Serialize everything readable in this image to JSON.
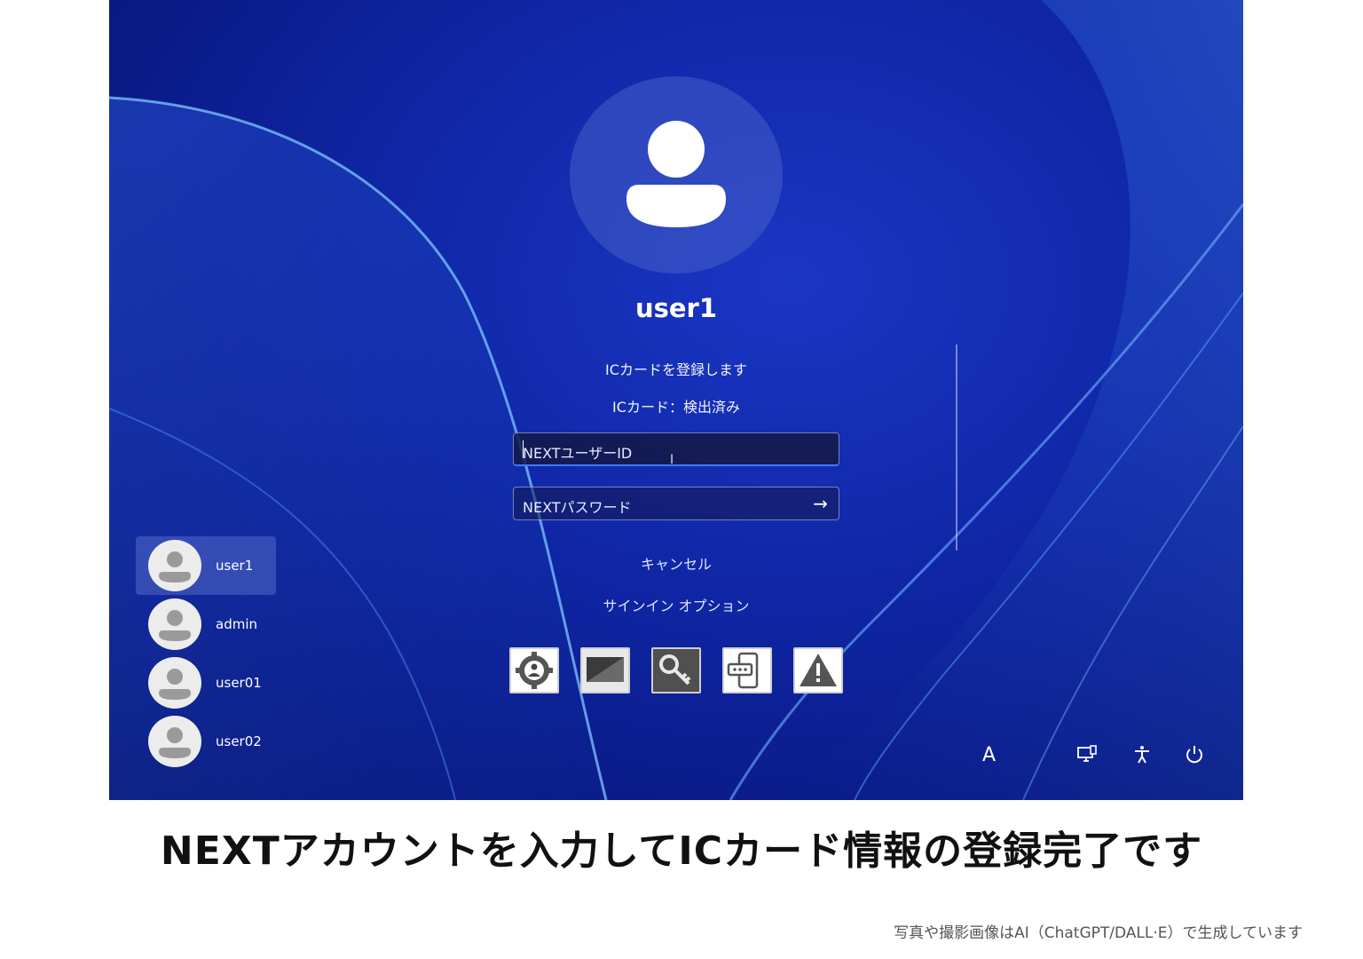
{
  "login": {
    "username": "user1",
    "message1": "ICカードを登録します",
    "message2": "ICカード：検出済み",
    "userid_placeholder": "NEXTユーザーID",
    "password_placeholder": "NEXTパスワード",
    "cancel_label": "キャンセル",
    "signin_options_label": "サインイン オプション"
  },
  "user_list": [
    {
      "name": "user1",
      "selected": true
    },
    {
      "name": "admin",
      "selected": false
    },
    {
      "name": "user01",
      "selected": false
    },
    {
      "name": "user02",
      "selected": false
    }
  ],
  "signin_options": [
    {
      "icon": "settings-user-icon"
    },
    {
      "icon": "smartcard-icon"
    },
    {
      "icon": "key-icon"
    },
    {
      "icon": "phone-code-icon"
    },
    {
      "icon": "warning-icon"
    }
  ],
  "tray": {
    "input_indicator": "A",
    "icons": [
      "network-icon",
      "accessibility-icon",
      "power-icon"
    ]
  },
  "caption": "NEXTアカウントを入力してICカード情報の登録完了です",
  "note": "写真や撮影画像はAI（ChatGPT/DALL·E）で生成しています",
  "colors": {
    "accent": "#3c7bff",
    "background": "#1027a8"
  }
}
